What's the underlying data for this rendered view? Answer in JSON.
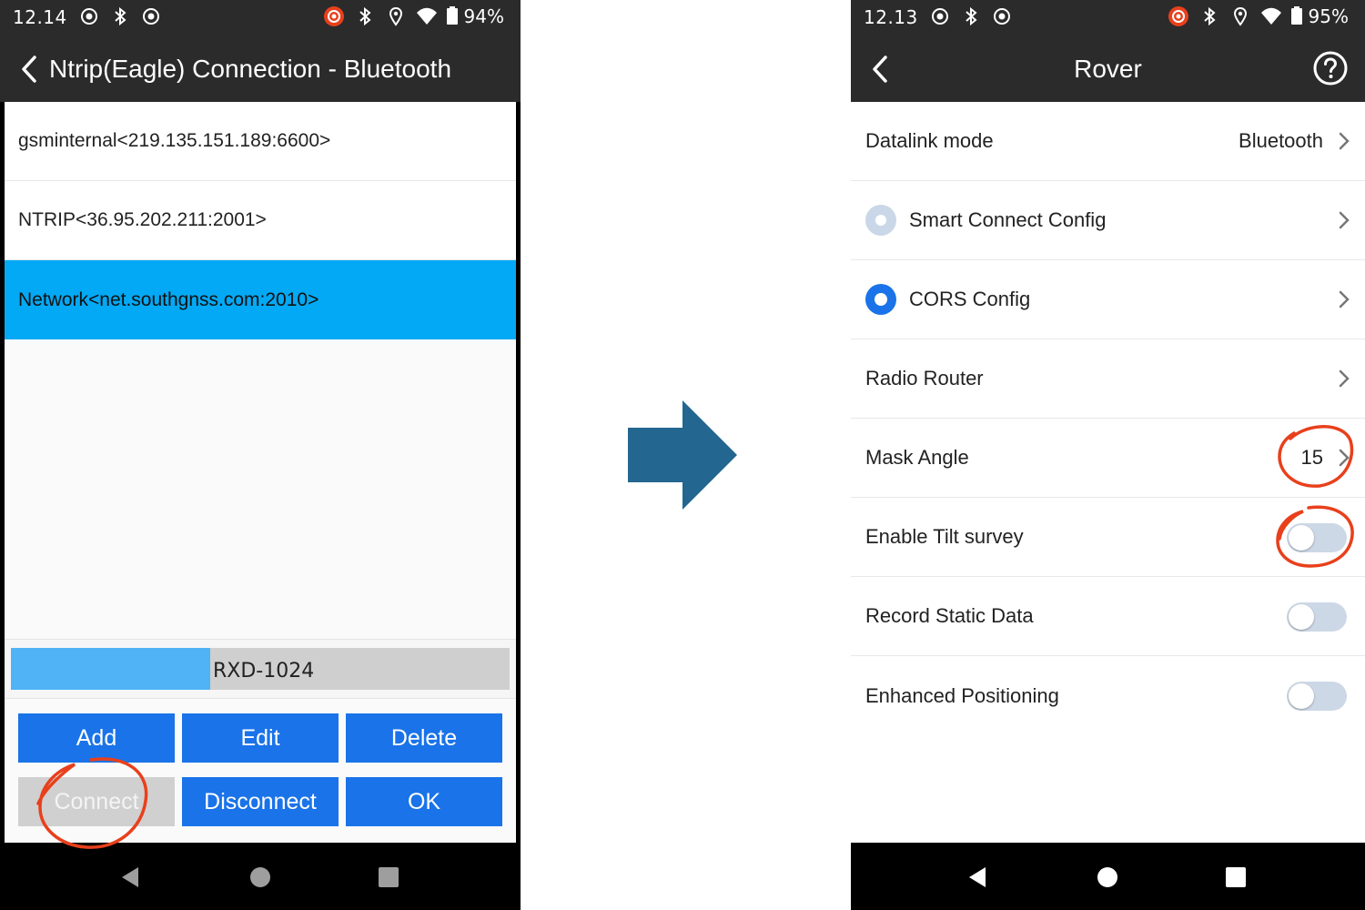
{
  "left_screen": {
    "status": {
      "time": "12.14",
      "battery": "94%"
    },
    "title": "Ntrip(Eagle) Connection - Bluetooth",
    "connections": [
      {
        "label": "gsminternal<219.135.151.189:6600>"
      },
      {
        "label": "NTRIP<36.95.202.211:2001>"
      },
      {
        "label": "Network<net.southgnss.com:2010>"
      }
    ],
    "progress": {
      "label": "RXD-1024",
      "fraction": 0.4
    },
    "buttons": {
      "add": "Add",
      "edit": "Edit",
      "delete": "Delete",
      "connect": "Connect",
      "disconnect": "Disconnect",
      "ok": "OK"
    }
  },
  "right_screen": {
    "status": {
      "time": "12.13",
      "battery": "95%"
    },
    "title": "Rover",
    "rows": {
      "datalink_label": "Datalink mode",
      "datalink_value": "Bluetooth",
      "smart_connect": "Smart Connect Config",
      "cors_config": "CORS Config",
      "radio_router": "Radio Router",
      "mask_angle_label": "Mask Angle",
      "mask_angle_value": "15",
      "tilt_survey": "Enable Tilt survey",
      "record_static": "Record Static Data",
      "enhanced_positioning": "Enhanced Positioning"
    }
  },
  "colors": {
    "accent_blue": "#1a73e8",
    "selected_row": "#03a9f4",
    "arrow": "#236690",
    "annotation": "#e8401c"
  },
  "icons": [
    "back-chevron-icon",
    "help-circle-icon",
    "chevron-right-icon",
    "bluetooth-icon",
    "location-icon",
    "wifi-icon",
    "battery-icon",
    "nav-back-icon",
    "nav-home-icon",
    "nav-recents-icon",
    "right-arrow-icon"
  ]
}
